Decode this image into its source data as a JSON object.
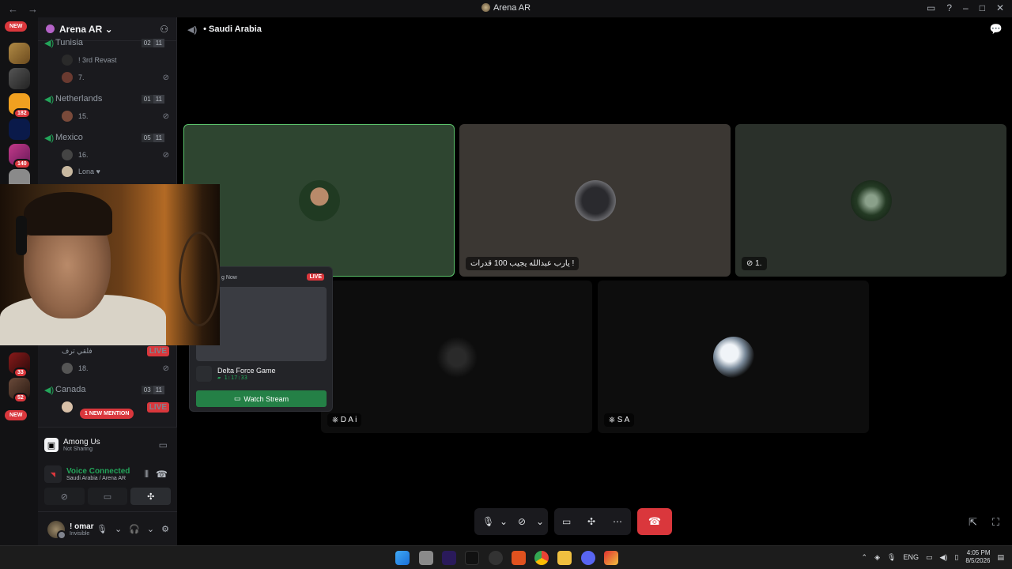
{
  "window": {
    "title": "Arena AR"
  },
  "guilds": {
    "new_top": "NEW",
    "new_bottom": "NEW",
    "badges": [
      "182",
      "140",
      "33",
      "52"
    ]
  },
  "sidebar": {
    "server_name": "Arena AR",
    "channels": [
      {
        "name": "Tunisia",
        "c1": "02",
        "c2": "11"
      },
      {
        "name": "Netherlands",
        "c1": "01",
        "c2": "11"
      },
      {
        "name": "Mexico",
        "c1": "05",
        "c2": "11"
      },
      {
        "name": "Canada",
        "c1": "03",
        "c2": "11"
      }
    ],
    "members": [
      {
        "name": "! 3rd Revast"
      },
      {
        "name": "7."
      },
      {
        "name": "15."
      },
      {
        "name": "16."
      },
      {
        "name": "Lona"
      },
      {
        "name": "فلقي ترف"
      },
      {
        "name": "18."
      }
    ],
    "live_label": "LIVE",
    "mention": "1 NEW MENTION"
  },
  "activity": {
    "game": "Among Us",
    "status": "Not Sharing"
  },
  "voice": {
    "status": "Voice Connected",
    "location": "Saudi Arabia / Arena AR"
  },
  "user": {
    "name": "! omar",
    "status": "Invisible"
  },
  "stage": {
    "channel": "Saudi Arabia",
    "tiles": [
      {
        "label": ""
      },
      {
        "label": "يارب عبدالله يجيب 100 قدرات !"
      },
      {
        "label": "1."
      },
      {
        "label": "D A i"
      },
      {
        "label": "S A"
      }
    ]
  },
  "stream_popup": {
    "header": "g Now",
    "live": "LIVE",
    "game": "Delta Force Game",
    "time": "1:17:33",
    "button": "Watch Stream"
  },
  "taskbar": {
    "lang": "ENG",
    "time": "4:05 PM",
    "date": "8/5/2026"
  },
  "colors": {
    "green": "#23a55a",
    "red": "#da373c",
    "accent": "#248046"
  }
}
